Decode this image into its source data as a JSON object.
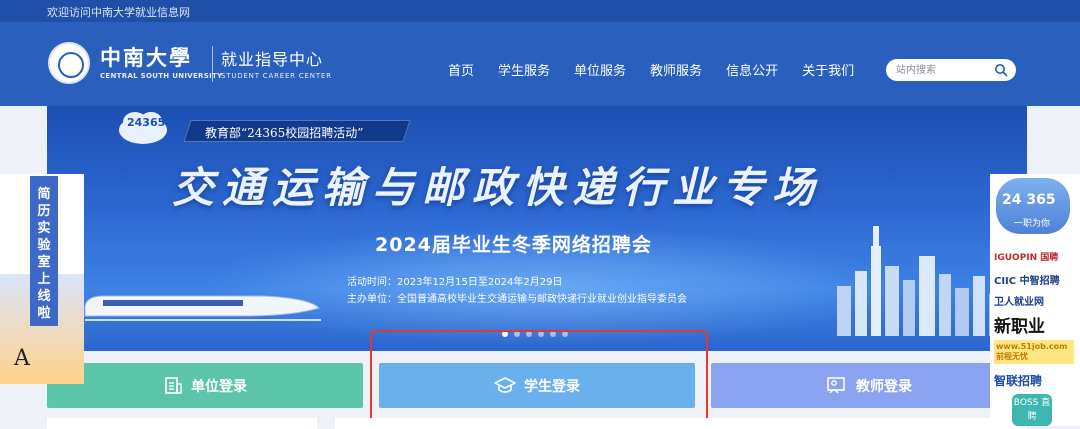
{
  "topbar": {
    "welcome": "欢迎访问中南大学就业信息网"
  },
  "header": {
    "logo_cn": "中南大學",
    "logo_en": "CENTRAL SOUTH UNIVERSITY",
    "center_cn": "就业指导中心",
    "center_en": "STUDENT CAREER CENTER"
  },
  "nav": [
    {
      "label": "首页"
    },
    {
      "label": "学生服务"
    },
    {
      "label": "单位服务"
    },
    {
      "label": "教师服务"
    },
    {
      "label": "信息公开"
    },
    {
      "label": "关于我们"
    }
  ],
  "search": {
    "placeholder": "站内搜索"
  },
  "banner": {
    "badge": "24365",
    "ribbon": "教育部“24365校园招聘活动”",
    "title": "交通运输与邮政快递行业专场",
    "subtitle": "2024届毕业生冬季网络招聘会",
    "time": "活动时间：2023年12月15日至2024年2月29日",
    "organizer": "主办单位：全国普通高校毕业生交通运输与邮政快递行业就业创业指导委员会",
    "slide_count": 6,
    "active_slide": 1
  },
  "login": {
    "unit": "单位登录",
    "student": "学生登录",
    "teacher": "教师登录"
  },
  "left_ad": {
    "text": "简历实验室上线啦",
    "corner": "A"
  },
  "right_ad": {
    "badge": "24 365",
    "slogan": "一职为你",
    "partners": [
      "IGUOPIN 国聘",
      "CIIC 中智招聘",
      "卫人就业网",
      "新职业",
      "www.51job.com 前程无忧",
      "智联招聘"
    ],
    "boss": "BOSS 直聘"
  },
  "colors": {
    "header": "#2a5fbe",
    "login_unit": "#5cc4a8",
    "login_student": "#6ab0ec",
    "login_teacher": "#8aa3f0",
    "highlight": "#e0392e"
  }
}
